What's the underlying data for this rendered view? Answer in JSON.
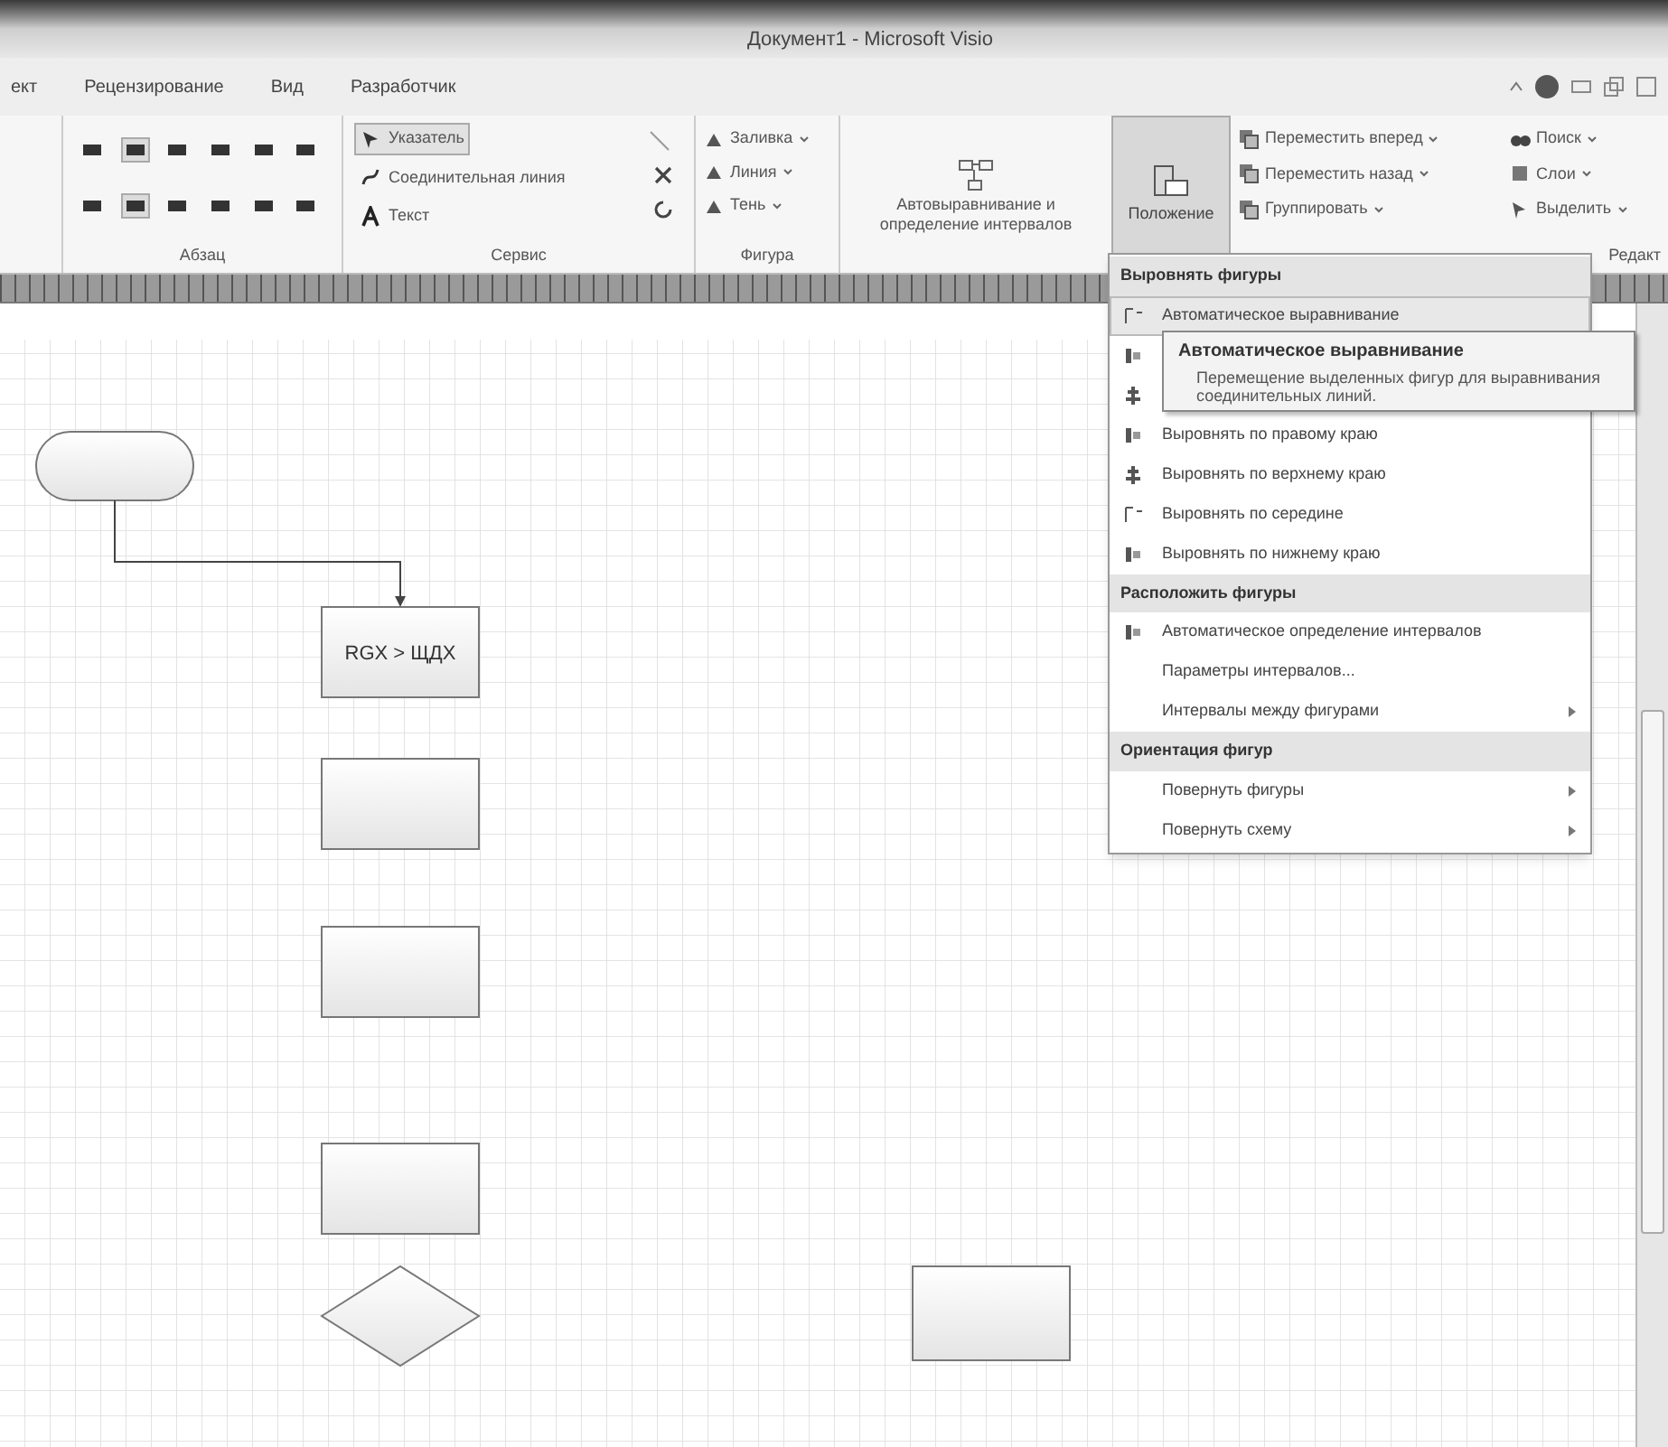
{
  "window": {
    "title": "Документ1 - Microsoft Visio"
  },
  "tabs": [
    {
      "label": "ект",
      "selected": false
    },
    {
      "label": "Рецензирование",
      "selected": false
    },
    {
      "label": "Вид",
      "selected": false
    },
    {
      "label": "Разработчик",
      "selected": false
    }
  ],
  "ribbon": {
    "paragraph_group": {
      "label": "Абзац"
    },
    "tools_group": {
      "label": "Сервис",
      "items": [
        {
          "label": "Указатель",
          "selected": true
        },
        {
          "label": "Соединительная линия",
          "selected": false
        },
        {
          "label": "Текст",
          "selected": false
        }
      ]
    },
    "shape_group": {
      "label": "Фигура",
      "items": [
        "Заливка",
        "Линия",
        "Тень"
      ]
    },
    "auto_align_button": {
      "label": "Автовыравнивание и определение интервалов"
    },
    "position_button": {
      "label": "Положение",
      "selected": true
    },
    "arrange_items": [
      "Переместить вперед",
      "Переместить назад",
      "Группировать"
    ],
    "editing_items": [
      "Поиск",
      "Слои",
      "Выделить"
    ],
    "editing_group": {
      "label": "Редакт"
    }
  },
  "menu": {
    "sections": [
      {
        "header": "Выровнять фигуры",
        "items": [
          {
            "label": "Автоматическое выравнивание",
            "selected": true,
            "submenu": false
          },
          {
            "label": "Выровнять по правому краю",
            "selected": false,
            "submenu": false
          },
          {
            "label": "Выровнять по верхнему краю",
            "selected": false,
            "submenu": false
          },
          {
            "label": "Выровнять по середине",
            "selected": false,
            "submenu": false
          },
          {
            "label": "Выровнять по нижнему краю",
            "selected": false,
            "submenu": false
          }
        ]
      },
      {
        "header": "Расположить фигуры",
        "items": [
          {
            "label": "Автоматическое определение интервалов",
            "selected": false,
            "submenu": false
          },
          {
            "label": "Параметры интервалов...",
            "selected": false,
            "submenu": false
          },
          {
            "label": "Интервалы между фигурами",
            "selected": false,
            "submenu": true
          }
        ]
      },
      {
        "header": "Ориентация фигур",
        "items": [
          {
            "label": "Повернуть фигуры",
            "selected": false,
            "submenu": true
          },
          {
            "label": "Повернуть схему",
            "selected": false,
            "submenu": true
          }
        ]
      }
    ]
  },
  "tooltip": {
    "title": "Автоматическое выравнивание",
    "text": "Перемещение выделенных фигур для выравнивания соединительных линий."
  },
  "diagram": {
    "shapes": [
      {
        "kind": "terminator"
      },
      {
        "kind": "process",
        "text": "RGX > ЩДХ"
      },
      {
        "kind": "process"
      },
      {
        "kind": "process"
      },
      {
        "kind": "process"
      },
      {
        "kind": "decision"
      },
      {
        "kind": "process"
      }
    ]
  }
}
